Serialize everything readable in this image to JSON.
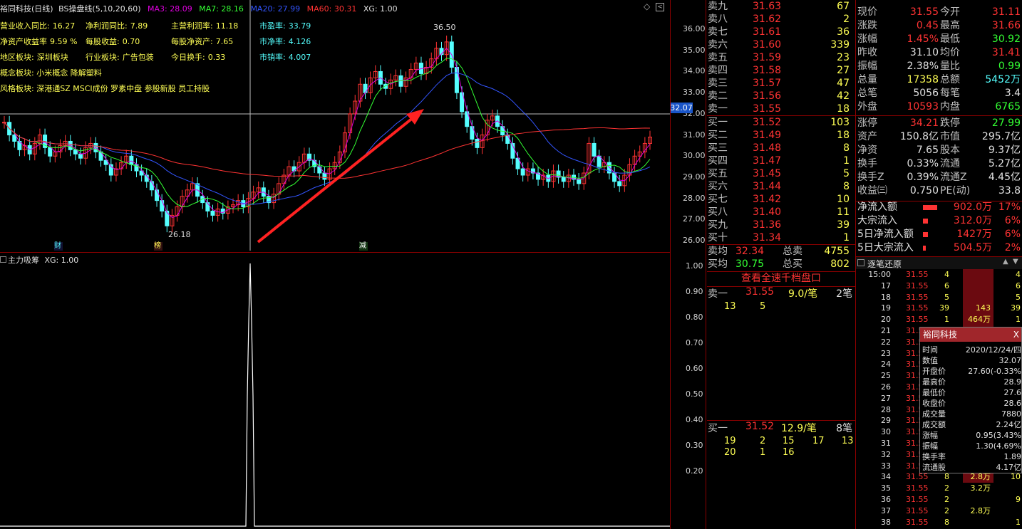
{
  "header": {
    "stock_name": "裕同科技",
    "period": "(日线)",
    "indicator": "BS操盘线(5,10,20,60)",
    "ma3": "MA3: 28.09",
    "ma7": "MA7: 28.16",
    "ma20": "MA20: 27.99",
    "ma60": "MA60: 30.31",
    "xg": "XG: 1.00"
  },
  "fundamentals": {
    "rows": [
      {
        "a_lab": "营业收入同比:",
        "a_val": "16.27",
        "b_lab": "净利润同比:",
        "b_val": "7.89",
        "c_lab": "主营利润率:",
        "c_val": "11.18",
        "d_lab": "市盈率:",
        "d_val": "33.79"
      },
      {
        "a_lab": "净资产收益率",
        "a_val": "9.59 %",
        "b_lab": "每股收益:",
        "b_val": "0.70",
        "c_lab": "每股净资产:",
        "c_val": "7.65",
        "d_lab": "市净率:",
        "d_val": "4.126"
      },
      {
        "a_lab": "地区板块:",
        "a_val": "深圳板块",
        "b_lab": "行业板块:",
        "b_val": "广告包装",
        "c_lab": "今日换手:",
        "c_val": "0.33",
        "d_lab": "市销率:",
        "d_val": "4.007"
      }
    ],
    "concept": "概念板块: 小米概念 降解塑料",
    "style": "风格板块: 深港通SZ MSCI成份 罗素中盘 参股新股 员工持股"
  },
  "price_axis": [
    "36.00",
    "35.00",
    "34.00",
    "33.00",
    "32.00",
    "31.00",
    "30.00",
    "29.00",
    "28.00",
    "27.00",
    "26.00"
  ],
  "current_price_tag": "32.07",
  "high_label": "36.50",
  "low_label": "26.18",
  "event_markers": [
    "财",
    "榜",
    "减"
  ],
  "bottom_indicator": {
    "title": "主力吸筹",
    "xg": "XG: 1.00",
    "axis": [
      "1.00",
      "0.90",
      "0.80",
      "0.70",
      "0.60",
      "0.50",
      "0.40",
      "0.30",
      "0.20"
    ]
  },
  "orderbook": {
    "asks": [
      {
        "name": "卖九",
        "price": "31.63",
        "qty": "67"
      },
      {
        "name": "卖八",
        "price": "31.62",
        "qty": "2"
      },
      {
        "name": "卖七",
        "price": "31.61",
        "qty": "36"
      },
      {
        "name": "卖六",
        "price": "31.60",
        "qty": "339"
      },
      {
        "name": "卖五",
        "price": "31.59",
        "qty": "23"
      },
      {
        "name": "卖四",
        "price": "31.58",
        "qty": "27"
      },
      {
        "name": "卖三",
        "price": "31.57",
        "qty": "47"
      },
      {
        "name": "卖二",
        "price": "31.56",
        "qty": "42"
      },
      {
        "name": "卖一",
        "price": "31.55",
        "qty": "18"
      }
    ],
    "bids": [
      {
        "name": "买一",
        "price": "31.52",
        "qty": "103"
      },
      {
        "name": "买二",
        "price": "31.49",
        "qty": "18"
      },
      {
        "name": "买三",
        "price": "31.48",
        "qty": "8"
      },
      {
        "name": "买四",
        "price": "31.47",
        "qty": "1"
      },
      {
        "name": "买五",
        "price": "31.45",
        "qty": "5"
      },
      {
        "name": "买六",
        "price": "31.44",
        "qty": "8"
      },
      {
        "name": "买七",
        "price": "31.42",
        "qty": "10"
      },
      {
        "name": "买八",
        "price": "31.40",
        "qty": "11"
      },
      {
        "name": "买九",
        "price": "31.36",
        "qty": "39"
      },
      {
        "name": "买十",
        "price": "31.34",
        "qty": "1"
      }
    ],
    "sell_avg_label": "卖均",
    "sell_avg": "32.34",
    "sell_total_label": "总卖",
    "sell_total": "4755",
    "buy_avg_label": "买均",
    "buy_avg": "30.75",
    "buy_total_label": "总买",
    "buy_total": "802",
    "full_btn": "查看全速千档盘口",
    "ask1_label": "卖一",
    "ask1_price": "31.55",
    "ask1_vol": "9.0/笔",
    "ask1_cnt": "2笔",
    "ask1_detail": [
      "13",
      "5"
    ],
    "bid1_label": "买一",
    "bid1_price": "31.52",
    "bid1_vol": "12.9/笔",
    "bid1_cnt": "8笔",
    "bid1_detail_1": [
      "19",
      "2",
      "15",
      "17",
      "13"
    ],
    "bid1_detail_2": [
      "20",
      "1",
      "16"
    ]
  },
  "quote": {
    "rows": [
      {
        "l1": "现价",
        "v1": "31.55",
        "l2": "今开",
        "v2": "31.11"
      },
      {
        "l1": "涨跌",
        "v1": "0.45",
        "l2": "最高",
        "v2": "31.66"
      },
      {
        "l1": "涨幅",
        "v1": "1.45%",
        "l2": "最低",
        "v2": "30.92"
      },
      {
        "l1": "昨收",
        "v1": "31.10",
        "l2": "均价",
        "v2": "31.41"
      },
      {
        "l1": "振幅",
        "v1": "2.38%",
        "l2": "量比",
        "v2": "0.99"
      },
      {
        "l1": "总量",
        "v1": "17358",
        "l2": "总额",
        "v2": "5452万"
      },
      {
        "l1": "总笔",
        "v1": "5056",
        "l2": "每笔",
        "v2": "3.4"
      },
      {
        "l1": "外盘",
        "v1": "10593",
        "l2": "内盘",
        "v2": "6765"
      },
      {
        "l1": "涨停",
        "v1": "34.21",
        "l2": "跌停",
        "v2": "27.99"
      },
      {
        "l1": "资产",
        "v1": "150.8亿",
        "l2": "市值",
        "v2": "295.7亿"
      },
      {
        "l1": "净资",
        "v1": "7.65",
        "l2": "股本",
        "v2": "9.37亿"
      },
      {
        "l1": "换手",
        "v1": "0.33%",
        "l2": "流通",
        "v2": "5.27亿"
      },
      {
        "l1": "换手Z",
        "v1": "0.39%",
        "l2": "流通Z",
        "v2": "4.45亿"
      },
      {
        "l1": "收益㈢",
        "v1": "0.750",
        "l2": "PE(动)",
        "v2": "33.8"
      }
    ],
    "flows": [
      {
        "label": "净流入额",
        "value": "902.0万",
        "pct": "17%",
        "level": 0.17
      },
      {
        "label": "大宗流入",
        "value": "312.0万",
        "pct": "6%",
        "level": 0.06
      },
      {
        "label": "5日净流入额",
        "value": "1427万",
        "pct": "6%",
        "level": 0.06
      },
      {
        "label": "5日大宗流入",
        "value": "504.5万",
        "pct": "2%",
        "level": 0.02
      }
    ]
  },
  "ticks": {
    "title": "逐笔还原",
    "rows": [
      {
        "t": "15:00",
        "p": "31.55",
        "v": "4",
        "r": "4"
      },
      {
        "t": "17",
        "p": "31.55",
        "v": "6",
        "r": "6"
      },
      {
        "t": "18",
        "p": "31.55",
        "v": "5",
        "r": "5"
      },
      {
        "t": "19",
        "p": "31.55",
        "v": "39",
        "r": "39",
        "m": "143"
      },
      {
        "t": "20",
        "p": "31.55",
        "v": "1",
        "r": "1",
        "m": "464万"
      },
      {
        "t": "21",
        "p": "31.55",
        "v": "",
        "r": ""
      },
      {
        "t": "22",
        "p": "31.55",
        "v": "",
        "r": ""
      },
      {
        "t": "23",
        "p": "31.55",
        "v": "",
        "r": ""
      },
      {
        "t": "24",
        "p": "31.55",
        "v": "",
        "r": ""
      },
      {
        "t": "25",
        "p": "31.55",
        "v": "",
        "r": ""
      },
      {
        "t": "26",
        "p": "31.55",
        "v": "",
        "r": ""
      },
      {
        "t": "27",
        "p": "31.55",
        "v": "",
        "r": ""
      },
      {
        "t": "28",
        "p": "31.55",
        "v": "",
        "r": ""
      },
      {
        "t": "29",
        "p": "31.55",
        "v": "",
        "r": ""
      },
      {
        "t": "30",
        "p": "31.55",
        "v": "",
        "r": ""
      },
      {
        "t": "31",
        "p": "31.55",
        "v": "",
        "r": ""
      },
      {
        "t": "32",
        "p": "31.55",
        "v": "",
        "r": ""
      },
      {
        "t": "33",
        "p": "31.55",
        "v": "",
        "r": ""
      },
      {
        "t": "34",
        "p": "31.55",
        "v": "8",
        "r": "10",
        "m": "2.8万"
      },
      {
        "t": "35",
        "p": "31.55",
        "v": "2",
        "r": "",
        "m": "3.2万"
      },
      {
        "t": "36",
        "p": "31.55",
        "v": "2",
        "r": "9"
      },
      {
        "t": "37",
        "p": "31.55",
        "v": "2",
        "r": "",
        "m": "2.8万"
      },
      {
        "t": "38",
        "p": "31.55",
        "v": "8",
        "r": "1"
      }
    ]
  },
  "popup": {
    "title": "裕同科技",
    "rows": [
      {
        "k": "时间",
        "v": "2020/12/24/四"
      },
      {
        "k": "数值",
        "v": "32.07"
      },
      {
        "k": "开盘价",
        "v": "27.60(-0.33%"
      },
      {
        "k": "最高价",
        "v": "28.9"
      },
      {
        "k": "最低价",
        "v": "27.6"
      },
      {
        "k": "收盘价",
        "v": "28.6"
      },
      {
        "k": "成交量",
        "v": "7880"
      },
      {
        "k": "成交额",
        "v": "2.24亿"
      },
      {
        "k": "涨幅",
        "v": "0.95(3.43%"
      },
      {
        "k": "振幅",
        "v": "1.30(4.69%"
      },
      {
        "k": "换手率",
        "v": "1.89"
      },
      {
        "k": "流通股",
        "v": "4.17亿"
      }
    ]
  },
  "colors": {
    "up": "#ff3333",
    "down": "#55ffff",
    "ma3": "#e000e0",
    "ma7": "#33ff33",
    "ma20": "#3355ff",
    "ma60": "#ff3333"
  }
}
